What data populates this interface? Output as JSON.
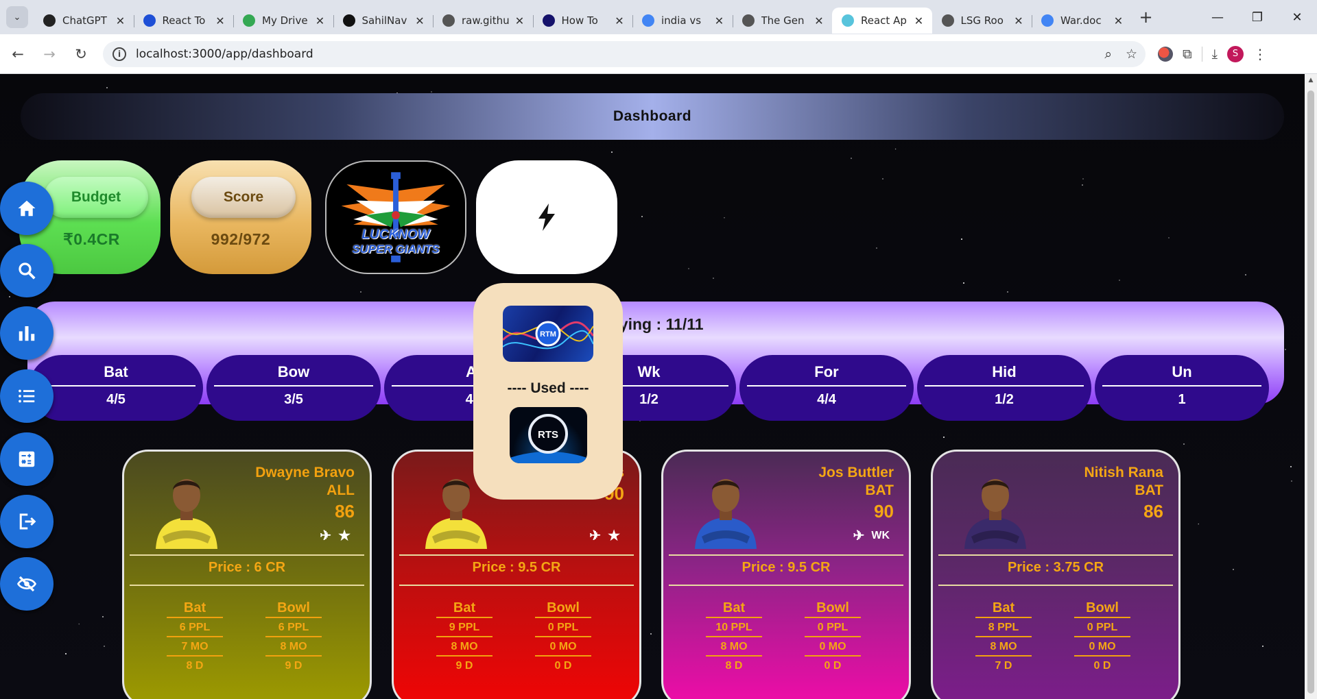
{
  "browser": {
    "tabs": [
      {
        "title": "ChatGPT",
        "favicon": "chatgpt-icon",
        "color": "#222222"
      },
      {
        "title": "React To",
        "favicon": "react-toastify-icon",
        "color": "#1e4fd6"
      },
      {
        "title": "My Drive",
        "favicon": "google-drive-icon",
        "color": "#34a853"
      },
      {
        "title": "SahilNav",
        "favicon": "github-icon",
        "color": "#111111"
      },
      {
        "title": "raw.githu",
        "favicon": "globe-icon",
        "color": "#555555"
      },
      {
        "title": "How To",
        "favicon": "b-icon",
        "color": "#15126b"
      },
      {
        "title": "india vs",
        "favicon": "google-icon",
        "color": "#4285f4"
      },
      {
        "title": "The Gen",
        "favicon": "search-doc-icon",
        "color": "#555555"
      },
      {
        "title": "React Ap",
        "favicon": "react-icon",
        "color": "#58c4dc",
        "active": true
      },
      {
        "title": "LSG Roo",
        "favicon": "globe-icon",
        "color": "#555555"
      },
      {
        "title": "War.doc",
        "favicon": "google-docs-icon",
        "color": "#4285f4"
      }
    ],
    "url": "localhost:3000/app/dashboard",
    "profile_initial": "S"
  },
  "dashboard": {
    "title": "Dashboard",
    "budget": {
      "label": "Budget",
      "value": "₹0.4CR"
    },
    "score": {
      "label": "Score",
      "value": "992/972"
    },
    "team_logo": {
      "line1": "LUCKNOW",
      "line2": "SUPER GIANTS"
    },
    "playing_text": "aying : 11/11",
    "categories": [
      {
        "name": "Bat",
        "value": "4/5"
      },
      {
        "name": "Bow",
        "value": "3/5"
      },
      {
        "name": "A",
        "value": "4/"
      },
      {
        "name": "Wk",
        "value": "1/2"
      },
      {
        "name": "For",
        "value": "4/4"
      },
      {
        "name": "Hid",
        "value": "1/2"
      },
      {
        "name": "Un",
        "value": "1"
      }
    ],
    "popup": {
      "rtm_label": "RTM",
      "used_text": "---- Used ----",
      "rts_label": "RTS"
    }
  },
  "sidebar": {
    "items": [
      "home-icon",
      "search-icon",
      "bar-chart-icon",
      "list-icon",
      "calculator-icon",
      "logout-icon",
      "eye-off-icon"
    ]
  },
  "players": [
    {
      "name": "Dwayne Bravo",
      "role": "ALL",
      "rating": "86",
      "overseas": true,
      "tag": "★",
      "price": "Price : 6 CR",
      "bat": [
        "6 PPL",
        "7 MO",
        "8 D"
      ],
      "bowl": [
        "6 PPL",
        "8 MO",
        "9 D"
      ],
      "jersey": "#f3e03a"
    },
    {
      "name": "s",
      "role": "",
      "rating": "90",
      "overseas": true,
      "tag": "★",
      "price": "Price : 9.5 CR",
      "bat": [
        "9 PPL",
        "8 MO",
        "9 D"
      ],
      "bowl": [
        "0 PPL",
        "0 MO",
        "0 D"
      ],
      "jersey": "#f3e03a"
    },
    {
      "name": "Jos Buttler",
      "role": "BAT",
      "rating": "90",
      "overseas": true,
      "tag": "WK",
      "price": "Price : 9.5 CR",
      "bat": [
        "10 PPL",
        "8 MO",
        "8 D"
      ],
      "bowl": [
        "0 PPL",
        "0 MO",
        "0 D"
      ],
      "jersey": "#2a5bc9"
    },
    {
      "name": "Nitish Rana",
      "role": "BAT",
      "rating": "86",
      "overseas": false,
      "tag": "",
      "price": "Price : 3.75 CR",
      "bat": [
        "8 PPL",
        "8 MO",
        "7 D"
      ],
      "bowl": [
        "0 PPL",
        "0 MO",
        "0 D"
      ],
      "jersey": "#3a2a6a"
    }
  ],
  "labels": {
    "bat": "Bat",
    "bowl": "Bowl"
  }
}
